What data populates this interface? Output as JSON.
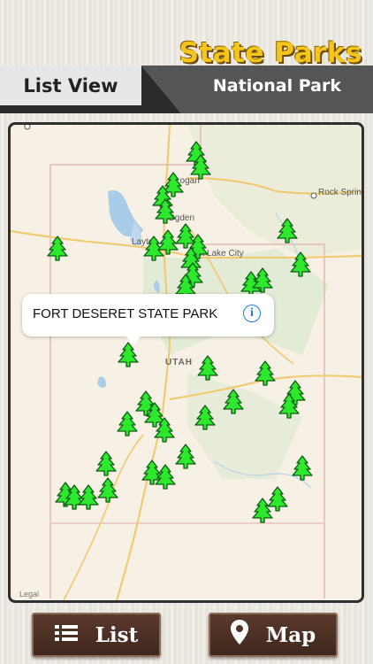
{
  "header": {
    "title": "State Parks",
    "subtitle": "National Park",
    "list_view_label": "List View"
  },
  "map": {
    "state_label": "UTAH",
    "city_labels": [
      "Logan",
      "Ogden",
      "Layton",
      "Salt Lake City",
      "Rock Springs"
    ],
    "legal_label": "Legal",
    "callout": {
      "title": "FORT DESERET STATE PARK",
      "info_icon": "info-circle-icon"
    },
    "marker_icon": "pine-tree-icon",
    "marker_color": "#2ee82e"
  },
  "buttons": {
    "list_label": "List",
    "list_icon": "list-icon",
    "map_label": "Map",
    "map_icon": "map-pin-icon"
  },
  "colors": {
    "title_yellow": "#f4c51a",
    "button_brown": "#4a2f23",
    "info_blue": "#1e7cf2"
  }
}
